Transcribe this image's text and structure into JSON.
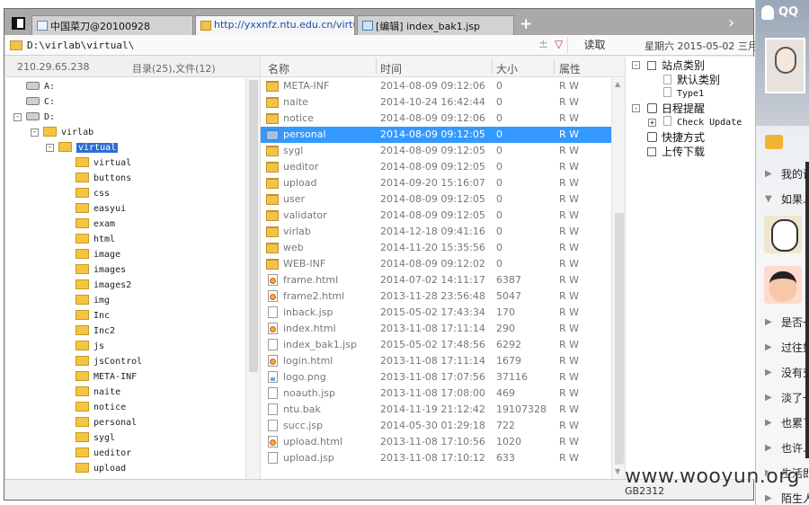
{
  "tabs": [
    {
      "label": "中国菜刀@20100928",
      "icon": "page-icon"
    },
    {
      "label": "http://yxxnfz.ntu.edu.cn/virtu...",
      "icon": "folder-icon"
    },
    {
      "label": "[编辑] index_bak1.jsp",
      "icon": "edit-icon"
    }
  ],
  "tabbar": {
    "new_tab": "+",
    "more": "›"
  },
  "address": {
    "path": "D:\\virlab\\virtual\\",
    "plus": "±",
    "dropdown": "▽",
    "read_button": "读取",
    "date": "星期六 2015-05-02 三月"
  },
  "left": {
    "ip": "210.29.65.238",
    "summary": "目录(25),文件(12)",
    "tree": [
      {
        "label": "A:",
        "type": "drive",
        "level": 0
      },
      {
        "label": "C:",
        "type": "drive",
        "level": 0
      },
      {
        "label": "D:",
        "type": "drive",
        "level": 0,
        "expander": "-"
      },
      {
        "label": "virlab",
        "type": "folder",
        "level": 1,
        "expander": "-"
      },
      {
        "label": "virtual",
        "type": "folder",
        "level": 2,
        "expander": "-",
        "selected": true
      },
      {
        "label": "virtual",
        "type": "folder",
        "level": 3
      },
      {
        "label": "buttons",
        "type": "folder",
        "level": 3
      },
      {
        "label": "css",
        "type": "folder",
        "level": 3
      },
      {
        "label": "easyui",
        "type": "folder",
        "level": 3
      },
      {
        "label": "exam",
        "type": "folder",
        "level": 3
      },
      {
        "label": "html",
        "type": "folder",
        "level": 3
      },
      {
        "label": "image",
        "type": "folder",
        "level": 3
      },
      {
        "label": "images",
        "type": "folder",
        "level": 3
      },
      {
        "label": "images2",
        "type": "folder",
        "level": 3
      },
      {
        "label": "img",
        "type": "folder",
        "level": 3
      },
      {
        "label": "Inc",
        "type": "folder",
        "level": 3
      },
      {
        "label": "Inc2",
        "type": "folder",
        "level": 3
      },
      {
        "label": "js",
        "type": "folder",
        "level": 3
      },
      {
        "label": "jsControl",
        "type": "folder",
        "level": 3
      },
      {
        "label": "META-INF",
        "type": "folder",
        "level": 3
      },
      {
        "label": "naite",
        "type": "folder",
        "level": 3
      },
      {
        "label": "notice",
        "type": "folder",
        "level": 3
      },
      {
        "label": "personal",
        "type": "folder",
        "level": 3
      },
      {
        "label": "sygl",
        "type": "folder",
        "level": 3
      },
      {
        "label": "ueditor",
        "type": "folder",
        "level": 3
      },
      {
        "label": "upload",
        "type": "folder",
        "level": 3
      }
    ]
  },
  "files": {
    "columns": {
      "name": "名称",
      "time": "时间",
      "size": "大小",
      "attr": "属性"
    },
    "rows": [
      {
        "name": "META-INF",
        "time": "2014-08-09 09:12:06",
        "size": "0",
        "attr": "R W",
        "icon": "folder"
      },
      {
        "name": "naite",
        "time": "2014-10-24 16:42:44",
        "size": "0",
        "attr": "R W",
        "icon": "folder"
      },
      {
        "name": "notice",
        "time": "2014-08-09 09:12:06",
        "size": "0",
        "attr": "R W",
        "icon": "folder"
      },
      {
        "name": "personal",
        "time": "2014-08-09 09:12:05",
        "size": "0",
        "attr": "R W",
        "icon": "folder-blue",
        "selected": true
      },
      {
        "name": "sygl",
        "time": "2014-08-09 09:12:05",
        "size": "0",
        "attr": "R W",
        "icon": "folder"
      },
      {
        "name": "ueditor",
        "time": "2014-08-09 09:12:05",
        "size": "0",
        "attr": "R W",
        "icon": "folder"
      },
      {
        "name": "upload",
        "time": "2014-09-20 15:16:07",
        "size": "0",
        "attr": "R W",
        "icon": "folder"
      },
      {
        "name": "user",
        "time": "2014-08-09 09:12:05",
        "size": "0",
        "attr": "R W",
        "icon": "folder"
      },
      {
        "name": "validator",
        "time": "2014-08-09 09:12:05",
        "size": "0",
        "attr": "R W",
        "icon": "folder"
      },
      {
        "name": "virlab",
        "time": "2014-12-18 09:41:16",
        "size": "0",
        "attr": "R W",
        "icon": "folder"
      },
      {
        "name": "web",
        "time": "2014-11-20 15:35:56",
        "size": "0",
        "attr": "R W",
        "icon": "folder"
      },
      {
        "name": "WEB-INF",
        "time": "2014-08-09 09:12:02",
        "size": "0",
        "attr": "R W",
        "icon": "folder"
      },
      {
        "name": "frame.html",
        "time": "2014-07-02 14:11:17",
        "size": "6387",
        "attr": "R W",
        "icon": "ie"
      },
      {
        "name": "frame2.html",
        "time": "2013-11-28 23:56:48",
        "size": "5047",
        "attr": "R W",
        "icon": "ie"
      },
      {
        "name": "inback.jsp",
        "time": "2015-05-02 17:43:34",
        "size": "170",
        "attr": "R W",
        "icon": "doc"
      },
      {
        "name": "index.html",
        "time": "2013-11-08 17:11:14",
        "size": "290",
        "attr": "R W",
        "icon": "ie"
      },
      {
        "name": "index_bak1.jsp",
        "time": "2015-05-02 17:48:56",
        "size": "6292",
        "attr": "R W",
        "icon": "doc"
      },
      {
        "name": "login.html",
        "time": "2013-11-08 17:11:14",
        "size": "1679",
        "attr": "R W",
        "icon": "ie"
      },
      {
        "name": "logo.png",
        "time": "2013-11-08 17:07:56",
        "size": "37116",
        "attr": "R W",
        "icon": "img"
      },
      {
        "name": "noauth.jsp",
        "time": "2013-11-08 17:08:00",
        "size": "469",
        "attr": "R W",
        "icon": "doc"
      },
      {
        "name": "ntu.bak",
        "time": "2014-11-19 21:12:42",
        "size": "19107328",
        "attr": "R W",
        "icon": "doc"
      },
      {
        "name": "succ.jsp",
        "time": "2014-05-30 01:29:18",
        "size": "722",
        "attr": "R W",
        "icon": "doc"
      },
      {
        "name": "upload.html",
        "time": "2013-11-08 17:10:56",
        "size": "1020",
        "attr": "R W",
        "icon": "ie"
      },
      {
        "name": "upload.jsp",
        "time": "2013-11-08 17:10:12",
        "size": "633",
        "attr": "R W",
        "icon": "doc"
      }
    ]
  },
  "right": {
    "nodes": [
      {
        "label": "站点类别",
        "expander": "-",
        "icon": "box",
        "level": 0
      },
      {
        "label": "默认类别",
        "icon": "page",
        "level": 1
      },
      {
        "label": "Type1",
        "icon": "page",
        "level": 1,
        "small": true
      },
      {
        "label": "日程提醒",
        "expander": "-",
        "icon": "calendar",
        "level": 0
      },
      {
        "label": "Check Update",
        "expander": "+",
        "icon": "page",
        "level": 1,
        "small": true
      },
      {
        "label": "快捷方式",
        "icon": "hand",
        "level": 0
      },
      {
        "label": "上传下载",
        "icon": "box",
        "level": 0
      }
    ]
  },
  "status": {
    "encoding": "GB2312"
  },
  "qq": {
    "title": "QQ",
    "items": [
      {
        "label": "我的设",
        "arrow": "▶"
      },
      {
        "label": "如果…",
        "arrow": "▼"
      },
      {
        "label": "是否一",
        "arrow": "▶"
      },
      {
        "label": "过往如",
        "arrow": "▶"
      },
      {
        "label": "没有交",
        "arrow": "▶"
      },
      {
        "label": "淡了一",
        "arrow": "▶"
      },
      {
        "label": "也累了",
        "arrow": "▶"
      },
      {
        "label": "也许…",
        "arrow": "▶"
      },
      {
        "label": "生活即",
        "arrow": "▶"
      },
      {
        "label": "陌生人",
        "arrow": "▶"
      }
    ]
  },
  "watermark": "www.wooyun.org"
}
